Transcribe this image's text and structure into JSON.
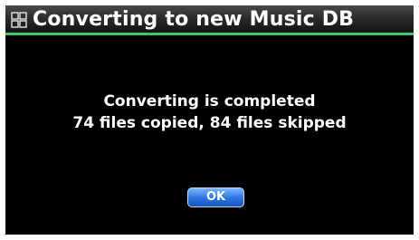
{
  "dialog": {
    "title": "Converting to new Music DB",
    "title_icon": "grid-icon",
    "message_line1": "Converting is completed",
    "message_line2": "74 files copied, 84 files skipped",
    "ok_label": "OK"
  },
  "colors": {
    "background": "#000000",
    "title_accent": "#3ec76a",
    "button": "#2f78e6",
    "text": "#ffffff"
  }
}
